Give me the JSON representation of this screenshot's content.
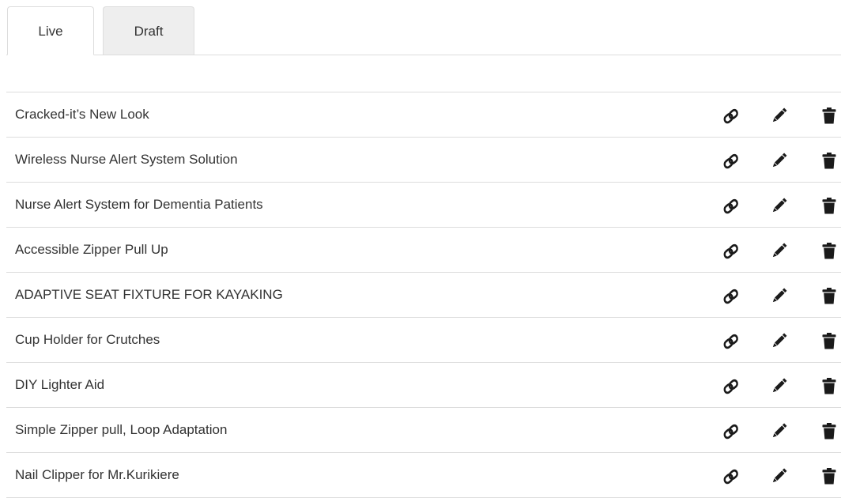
{
  "tabs": [
    {
      "label": "Live",
      "active": true
    },
    {
      "label": "Draft",
      "active": false
    }
  ],
  "icons": {
    "link": "link-icon",
    "edit": "pencil-icon",
    "delete": "trash-icon"
  },
  "colors": {
    "icon": "#1a1a1a",
    "text": "#333333",
    "border": "#dddddd",
    "inactive_tab_bg": "#eeeeee"
  },
  "items": [
    {
      "title": "Cracked-it’s New Look"
    },
    {
      "title": "Wireless Nurse Alert System Solution"
    },
    {
      "title": "Nurse Alert System for Dementia Patients"
    },
    {
      "title": "Accessible Zipper Pull Up"
    },
    {
      "title": "ADAPTIVE SEAT FIXTURE FOR KAYAKING"
    },
    {
      "title": "Cup Holder for Crutches"
    },
    {
      "title": "DIY Lighter Aid"
    },
    {
      "title": "Simple Zipper pull, Loop Adaptation"
    },
    {
      "title": "Nail Clipper for Mr.Kurikiere"
    }
  ]
}
